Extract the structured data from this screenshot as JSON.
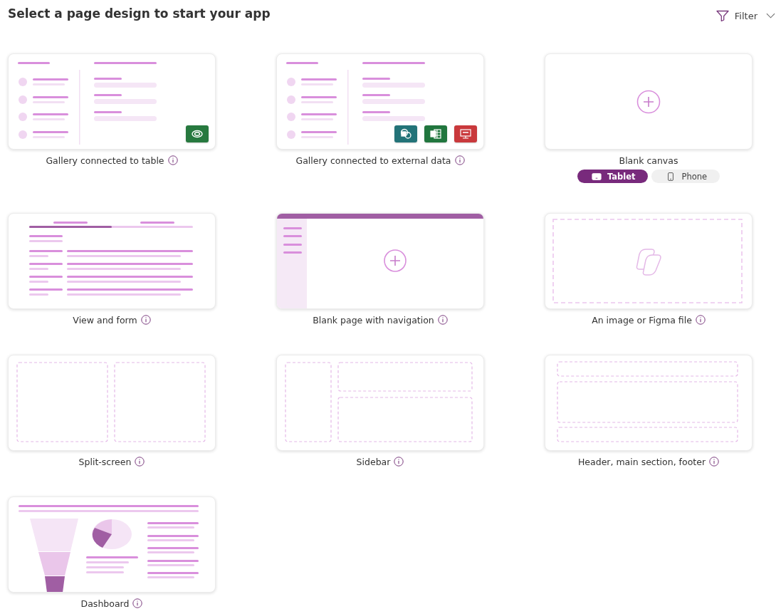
{
  "title": "Select a page design to start your app",
  "filter": {
    "label": "Filter"
  },
  "templates": [
    {
      "kind": "gallery",
      "name": "Gallery connected to table",
      "sources": [
        {
          "kind": "dataverse",
          "color": "#27793f"
        }
      ]
    },
    {
      "kind": "gallery",
      "name": "Gallery connected to external data",
      "sources": [
        {
          "kind": "sharepoint",
          "color": "#237378"
        },
        {
          "kind": "excel",
          "color": "#21763e"
        },
        {
          "kind": "sql",
          "color": "#c9393c"
        }
      ]
    },
    {
      "kind": "blank",
      "name": "Blank canvas",
      "form_factors": [
        {
          "kind": "tablet",
          "label": "Tablet",
          "selected": true
        },
        {
          "kind": "phone",
          "label": "Phone",
          "selected": false
        }
      ]
    },
    {
      "kind": "viewform",
      "name": "View and form"
    },
    {
      "kind": "blanknav",
      "name": "Blank page with navigation"
    },
    {
      "kind": "image",
      "name": "An image or Figma file"
    },
    {
      "kind": "split",
      "name": "Split-screen"
    },
    {
      "kind": "sidebar",
      "name": "Sidebar"
    },
    {
      "kind": "headerfooter",
      "name": "Header, main section, footer"
    },
    {
      "kind": "dashboard",
      "name": "Dashboard"
    }
  ]
}
